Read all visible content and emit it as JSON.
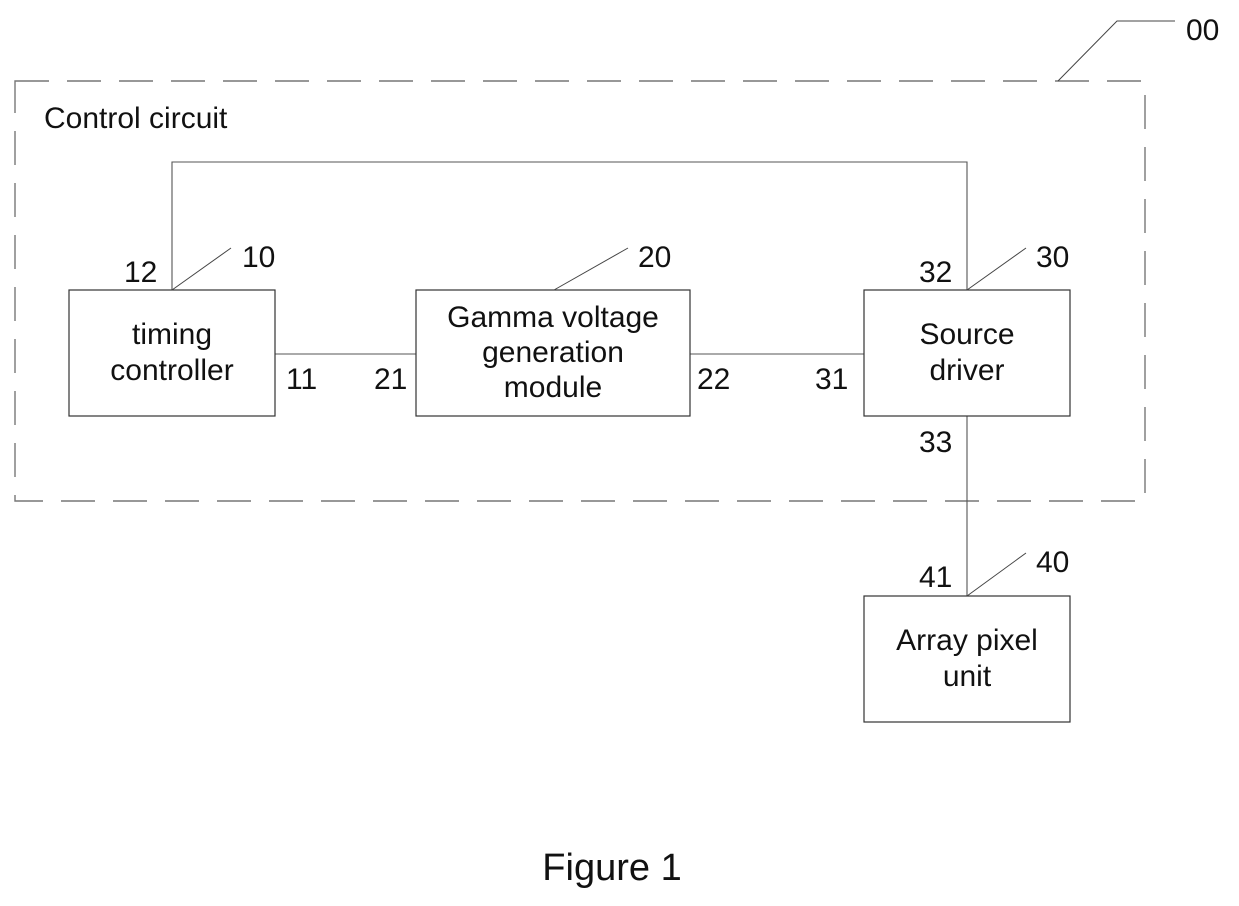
{
  "diagram": {
    "container": {
      "label": "Control circuit",
      "ref": "00"
    },
    "blocks": [
      {
        "id": "timing-controller",
        "ref": "10",
        "lines": [
          "timing",
          "controller"
        ]
      },
      {
        "id": "gamma-voltage-generation-module",
        "ref": "20",
        "lines": [
          "Gamma voltage",
          "generation",
          "module"
        ]
      },
      {
        "id": "source-driver",
        "ref": "30",
        "lines": [
          "Source",
          "driver"
        ]
      },
      {
        "id": "array-pixel-unit",
        "ref": "40",
        "lines": [
          "Array pixel",
          "unit"
        ]
      }
    ],
    "ports": {
      "p11": "11",
      "p12": "12",
      "p21": "21",
      "p22": "22",
      "p31": "31",
      "p32": "32",
      "p33": "33",
      "p41": "41"
    },
    "connections": [
      {
        "from": "11",
        "to": "21"
      },
      {
        "from": "22",
        "to": "31"
      },
      {
        "from": "12",
        "to": "32"
      },
      {
        "from": "33",
        "to": "41"
      }
    ]
  },
  "caption": "Figure 1"
}
